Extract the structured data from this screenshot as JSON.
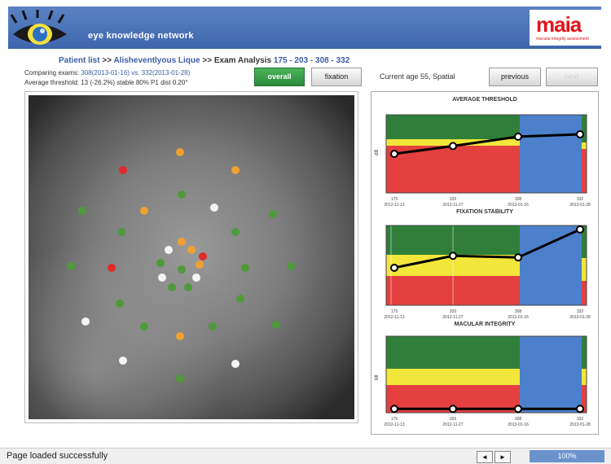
{
  "header": {
    "site_title": "eye knowledge network",
    "brand_name": "maia",
    "brand_sub": "macular integrity assessment"
  },
  "breadcrumb": {
    "patient_list": "Patient list",
    "sep": " >> ",
    "patient_name": "Alisheventlyous Lique",
    "exam_analysis": "Exam Analysis",
    "exam_ids": "175 - 203 - 308 - 332"
  },
  "info": {
    "comparing_label": "Comparing exams:",
    "comparing_value": "308(2013-01-16) vs. 332(2013-01-28)",
    "second_line": "Average threshold: 13  (-26.2%)   stable 80%   P1 dist 0.20°"
  },
  "buttons": {
    "overall": "overall",
    "fixation": "fixation",
    "previous": "previous",
    "next": "next"
  },
  "current_age": "Current age 55, Spatial",
  "charts": {
    "avg_threshold": {
      "title": "AVERAGE THRESHOLD",
      "y_label": "dB",
      "values": [
        0.5,
        0.6,
        0.72,
        0.75
      ],
      "ticks": [
        "175",
        "203",
        "308",
        "332"
      ],
      "dates": [
        "2012-11-13",
        "2012-11-27",
        "2013-01-16",
        "2013-01-28"
      ]
    },
    "fixation_stability": {
      "title": "FIXATION STABILITY",
      "values": [
        0.47,
        0.62,
        0.6,
        0.95
      ],
      "ticks": [
        "175",
        "203",
        "308",
        "332"
      ],
      "dates": [
        "2012-11-13",
        "2012-11-27",
        "2013-01-16",
        "2013-01-28"
      ]
    },
    "macular_integrity": {
      "title": "MACULAR INTEGRITY",
      "y_label": "MI",
      "values": [
        0.05,
        0.05,
        0.05,
        0.05
      ],
      "ticks": [
        "175",
        "203",
        "308",
        "332"
      ],
      "dates": [
        "2012-11-13",
        "2012-11-27",
        "2013-01-16",
        "2013-01-28"
      ]
    }
  },
  "fundus_points_note": "colored stimulus points",
  "status": {
    "message": "Page loaded successfully",
    "prev_nav": "◄",
    "next_nav": "►",
    "zoom": "100%"
  },
  "colors": {
    "green": "#4f9a3a",
    "orange": "#f0a030",
    "red": "#e02a2a",
    "white": "#f4f4f4",
    "band_green": "#2f7f3a",
    "band_yellow": "#f2e63a",
    "band_red": "#e44040",
    "band_blue": "#4d80cc"
  }
}
